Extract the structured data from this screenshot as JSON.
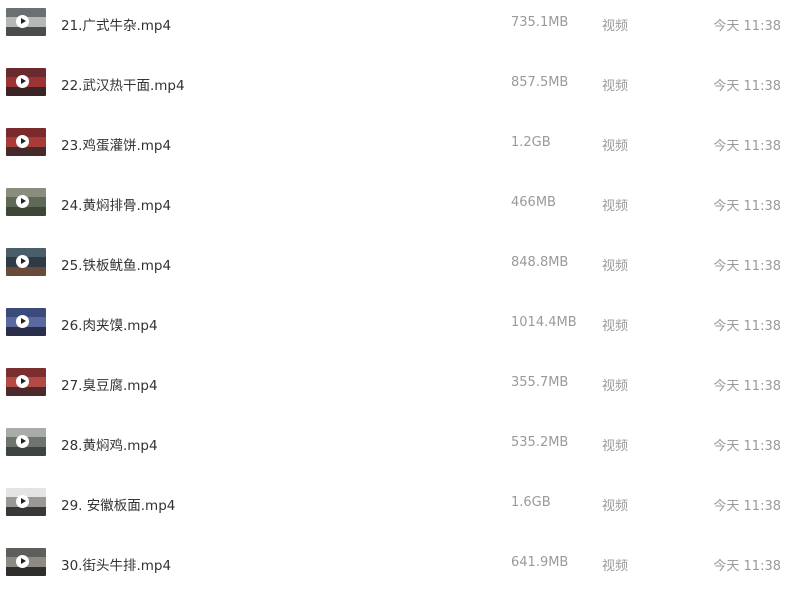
{
  "files": [
    {
      "name": "21.广式牛杂.mp4",
      "size": "735.1MB",
      "type": "视频",
      "time": "今天 11:38",
      "thumb": [
        "#6a6f72",
        "#b5b8b6",
        "#4a4d4e"
      ]
    },
    {
      "name": "22.武汉热干面.mp4",
      "size": "857.5MB",
      "type": "视频",
      "time": "今天 11:38",
      "thumb": [
        "#6b2a2e",
        "#9c3436",
        "#3a2426"
      ]
    },
    {
      "name": "23.鸡蛋灌饼.mp4",
      "size": "1.2GB",
      "type": "视频",
      "time": "今天 11:38",
      "thumb": [
        "#7a2a2c",
        "#a83a38",
        "#442a2a"
      ]
    },
    {
      "name": "24.黄焖排骨.mp4",
      "size": "466MB",
      "type": "视频",
      "time": "今天 11:38",
      "thumb": [
        "#8a8c7e",
        "#5e6a55",
        "#3e4636"
      ]
    },
    {
      "name": "25.铁板鱿鱼.mp4",
      "size": "848.8MB",
      "type": "视频",
      "time": "今天 11:38",
      "thumb": [
        "#4a5e6a",
        "#2e3a44",
        "#6a4a3a"
      ]
    },
    {
      "name": "26.肉夹馍.mp4",
      "size": "1014.4MB",
      "type": "视频",
      "time": "今天 11:38",
      "thumb": [
        "#3a4a7a",
        "#5a6aa0",
        "#2a2e4a"
      ]
    },
    {
      "name": "27.臭豆腐.mp4",
      "size": "355.7MB",
      "type": "视频",
      "time": "今天 11:38",
      "thumb": [
        "#7a2e2e",
        "#b44a44",
        "#4a2a2a"
      ]
    },
    {
      "name": "28.黄焖鸡.mp4",
      "size": "535.2MB",
      "type": "视频",
      "time": "今天 11:38",
      "thumb": [
        "#a8aca6",
        "#6e746e",
        "#3e4440"
      ]
    },
    {
      "name": "29. 安徽板面.mp4",
      "size": "1.6GB",
      "type": "视频",
      "time": "今天 11:38",
      "thumb": [
        "#e4e4e2",
        "#9a9896",
        "#3a3836"
      ]
    },
    {
      "name": "30.街头牛排.mp4",
      "size": "641.9MB",
      "type": "视频",
      "time": "今天 11:38",
      "thumb": [
        "#5e5e5c",
        "#8e8a84",
        "#2e2e2c"
      ]
    }
  ]
}
